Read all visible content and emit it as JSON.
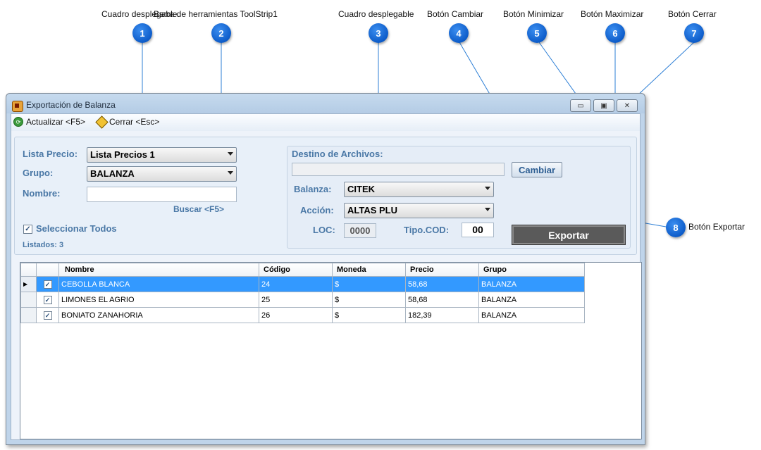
{
  "callouts": [
    {
      "n": "1",
      "label": "Cuadro desplegable"
    },
    {
      "n": "2",
      "label": "Barra de herramientas ToolStrip1"
    },
    {
      "n": "3",
      "label": "Cuadro desplegable"
    },
    {
      "n": "4",
      "label": "Botón Cambiar"
    },
    {
      "n": "5",
      "label": "Botón Minimizar"
    },
    {
      "n": "6",
      "label": "Botón Maximizar"
    },
    {
      "n": "7",
      "label": "Botón Cerrar"
    },
    {
      "n": "8",
      "label": "Botón Exportar"
    }
  ],
  "window": {
    "title": "Exportación de Balanza",
    "minimize_icon": "minimize-icon",
    "maximize_icon": "maximize-icon",
    "close_icon": "close-icon",
    "minimize_glyph": "▭",
    "maximize_glyph": "▣",
    "close_glyph": "✕"
  },
  "toolbar": {
    "refresh_label": "Actualizar <F5>",
    "close_label": "Cerrar <Esc>",
    "refresh_icon": "refresh-icon",
    "close_icon": "close-sign-icon"
  },
  "filters": {
    "lista_precio_label": "Lista Precio:",
    "lista_precio_value": "Lista Precios 1",
    "grupo_label": "Grupo:",
    "grupo_value": "BALANZA",
    "nombre_label": "Nombre:",
    "nombre_value": "",
    "buscar_label": "Buscar <F5>",
    "select_all_label": "Seleccionar Todos",
    "select_all_checked": "✓",
    "listados_label": "Listados: 3"
  },
  "export": {
    "destino_label": "Destino de Archivos:",
    "destino_value": "",
    "cambiar_label": "Cambiar",
    "balanza_label": "Balanza:",
    "balanza_value": "CITEK",
    "accion_label": "Acción:",
    "accion_value": "ALTAS PLU",
    "loc_label": "LOC:",
    "loc_value": "0000",
    "tipo_cod_label": "Tipo.COD:",
    "tipo_cod_value": "00",
    "exportar_label": "Exportar"
  },
  "grid": {
    "columns": [
      "Nombre",
      "Código",
      "Moneda",
      "Precio",
      "Grupo"
    ],
    "rows": [
      {
        "checked": "✓",
        "nombre": "CEBOLLA BLANCA",
        "codigo": "24",
        "moneda": "$",
        "precio": "58,68",
        "grupo": "BALANZA"
      },
      {
        "checked": "✓",
        "nombre": "LIMONES EL AGRIO",
        "codigo": "25",
        "moneda": "$",
        "precio": "58,68",
        "grupo": "BALANZA"
      },
      {
        "checked": "✓",
        "nombre": "BONIATO ZANAHORIA",
        "codigo": "26",
        "moneda": "$",
        "precio": "182,39",
        "grupo": "BALANZA"
      }
    ],
    "current_row_marker": "▶"
  },
  "colors": {
    "selection": "#3399ff",
    "label_blue": "#4a78a6",
    "badge_blue": "#0d5cc9"
  }
}
